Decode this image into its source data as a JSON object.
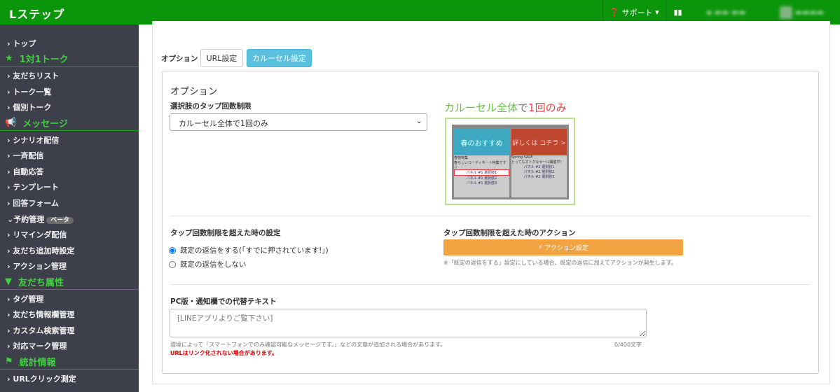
{
  "header": {
    "logo": "Lステップ",
    "support": "サポート",
    "support_icon": "question-circle-icon",
    "stats_icon": "bar-chart-icon",
    "account_blurred": "▪ ▬▬ ▬▬",
    "user_blurred": "▬▬▬▬"
  },
  "sidebar": {
    "top": "トップ",
    "sections": [
      {
        "title": "1対1トーク",
        "icon": "star-icon",
        "items": [
          "友だちリスト",
          "トーク一覧",
          "個別トーク"
        ]
      },
      {
        "title": "メッセージ",
        "icon": "megaphone-icon",
        "items": [
          "シナリオ配信",
          "一斉配信",
          "自動応答",
          "テンプレート",
          "回答フォーム"
        ]
      },
      {
        "title": "友だち属性",
        "icon": "filter-icon",
        "items": [
          "タグ管理",
          "友だち情報欄管理",
          "カスタム検索管理",
          "対応マーク管理"
        ]
      },
      {
        "title": "統計情報",
        "icon": "flag-icon",
        "items": [
          "URLクリック測定"
        ]
      }
    ],
    "reservation": {
      "label": "予約管理",
      "badge": "ベータ",
      "items": [
        "リマインダ配信",
        "友だち追加時設定",
        "アクション管理"
      ]
    }
  },
  "main": {
    "option_label": "オプション",
    "tab_url": "URL設定",
    "tab_carousel": "カルーセル設定",
    "box_title": "オプション",
    "tap_limit_label": "選択肢のタップ回数制限",
    "tap_limit_value": "カルーセル全体で1回のみ",
    "preview": {
      "caption_a": "カルーセル全体",
      "caption_b": "で",
      "caption_c": "1回のみ",
      "panel1_img": "春のおすすめ",
      "panel2_img": "詳しくは コチラ >",
      "panel1_title": "春物特集",
      "panel1_desc": "春らしいコーディネート特集です♫",
      "panel2_title": "Spring SALE",
      "panel2_desc": "とってもオトクなセール開催中！",
      "p1_choices": [
        "パネル #1 選択肢1",
        "パネル #1 選択肢2",
        "パネル #1 選択肢3"
      ],
      "p2_choices": [
        "パネル #2 選択肢1",
        "パネル #2 選択肢2",
        "パネル #2 選択肢3"
      ]
    },
    "exceed_label": "タップ回数制限を超えた時の設定",
    "radio1": "既定の返信をする(「すでに押されています!」)",
    "radio2": "既定の返信をしない",
    "action_label": "タップ回数制限を超えた時のアクション",
    "action_button": "アクション設定",
    "action_note": "※「既定の返信をする」設定にしている場合、既定の返信に加えてアクションが発生します。",
    "alt_label": "PC版・通知欄での代替テキスト",
    "alt_placeholder": "[LINEアプリよりご覧下さい]",
    "alt_note": "環境によって「スマートフォンでのみ確認可能なメッセージです。」などの文章が追加される場合があります。",
    "alt_count": "0/400文字",
    "alt_warning": "URLはリンク化されない場合があります。"
  },
  "colors": {
    "header": "#0b950b",
    "sidebar": "#3d3f4b",
    "accent": "#3ed13e",
    "tab_active": "#5bc0de",
    "action": "#f0a340",
    "warning": "#e00000"
  }
}
